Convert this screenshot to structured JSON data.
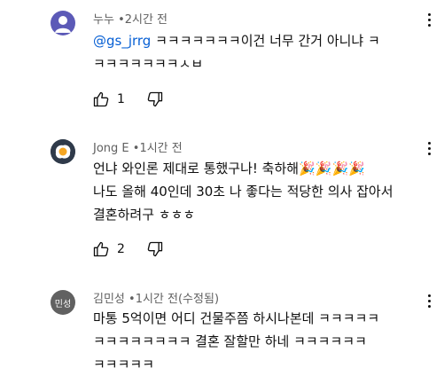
{
  "comments": [
    {
      "author": "누누",
      "separator": "•",
      "time": "2시간 전",
      "mention": "@gs_jrrg",
      "text": " ㅋㅋㅋㅋㅋㅋㅋ이건 너무 간거 아니냐 ㅋ\nㅋㅋㅋㅋㅋㅋㅋㅅㅂ",
      "likes": "1",
      "avatar": {
        "icon": "default-user-icon",
        "bg": "#5c5ab7"
      }
    },
    {
      "author": "Jong E",
      "separator": "•",
      "time": "1시간 전",
      "text": "언냐 와인론 제대로 통했구나! 축하해🎉🎉🎉🎉\n나도 올해 40인데 30초 나 좋다는 적당한 의사 잡아서\n결혼하려구 ㅎㅎㅎ",
      "likes": "2",
      "avatar": {
        "icon": "fried-egg-icon",
        "bg": "#2f3a4a"
      }
    },
    {
      "author": "김민성",
      "separator": "•",
      "time": "1시간 전(수정됨)",
      "text": "마통 5억이면 어디 건물주쯤 하시나본데 ㅋㅋㅋㅋㅋ\nㅋㅋㅋㅋㅋㅋㅋㅋ 결혼 잘할만 하네 ㅋㅋㅋㅋㅋㅋ\nㅋㅋㅋㅋㅋ",
      "avatar": {
        "label": "민성",
        "bg": "#616161"
      }
    }
  ]
}
